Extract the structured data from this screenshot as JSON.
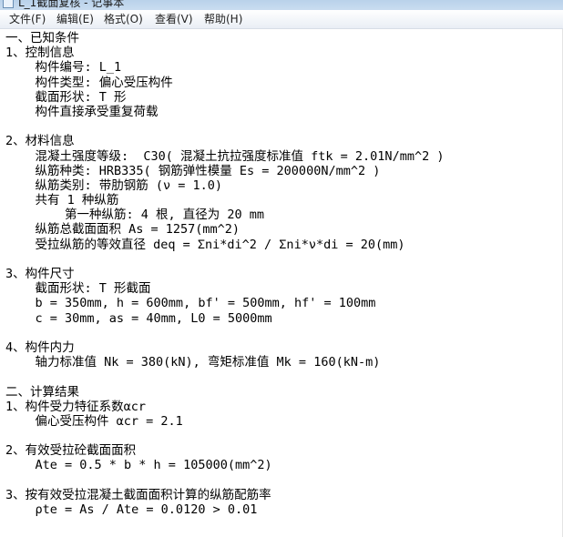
{
  "window": {
    "title": "L_1截面复核 - 记事本"
  },
  "menu": [
    {
      "label": "文件(F)"
    },
    {
      "label": "编辑(E)"
    },
    {
      "label": "格式(O)"
    },
    {
      "label": "查看(V)"
    },
    {
      "label": "帮助(H)"
    }
  ],
  "document": {
    "lines": [
      "一、已知条件",
      "1、控制信息",
      "    构件编号: L_1",
      "    构件类型: 偏心受压构件",
      "    截面形状: T 形",
      "    构件直接承受重复荷载",
      "",
      "2、材料信息",
      "    混凝土强度等级:  C30( 混凝土抗拉强度标准值 ftk = 2.01N/mm^2 )",
      "    纵筋种类: HRB335( 钢筋弹性模量 Es = 200000N/mm^2 )",
      "    纵筋类别: 带肋钢筋 (ν = 1.0)",
      "    共有 1 种纵筋",
      "        第一种纵筋: 4 根, 直径为 20 mm",
      "    纵筋总截面面积 As = 1257(mm^2)",
      "    受拉纵筋的等效直径 deq = Σni*di^2 / Σni*ν*di = 20(mm)",
      "",
      "3、构件尺寸",
      "    截面形状: T 形截面",
      "    b = 350mm, h = 600mm, bf' = 500mm, hf' = 100mm",
      "    c = 30mm, as = 40mm, L0 = 5000mm",
      "",
      "4、构件内力",
      "    轴力标准值 Nk = 380(kN), 弯矩标准值 Mk = 160(kN-m)",
      "",
      "二、计算结果",
      "1、构件受力特征系数αcr",
      "    偏心受压构件 αcr = 2.1",
      "",
      "2、有效受拉砼截面面积",
      "    Ate = 0.5 * b * h = 105000(mm^2)",
      "",
      "3、按有效受拉混凝土截面面积计算的纵筋配筋率",
      "    ρte = As / Ate = 0.0120 > 0.01"
    ]
  }
}
